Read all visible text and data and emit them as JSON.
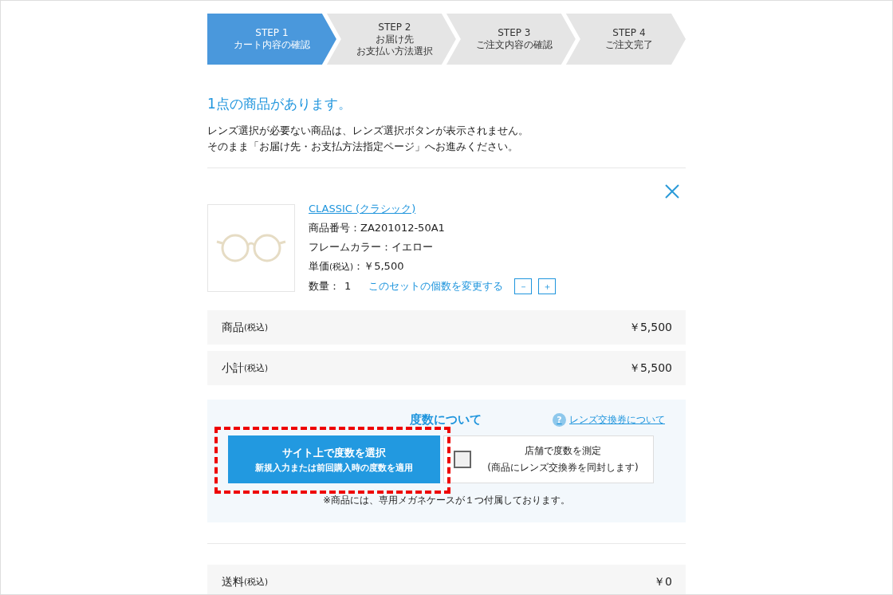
{
  "steps": [
    {
      "label": "STEP 1",
      "lines": [
        "カート内容の確認"
      ],
      "selected": true
    },
    {
      "label": "STEP 2",
      "lines": [
        "お届け先",
        "お支払い方法選択"
      ],
      "selected": false
    },
    {
      "label": "STEP 3",
      "lines": [
        "ご注文内容の確認"
      ],
      "selected": false
    },
    {
      "label": "STEP 4",
      "lines": [
        "ご注文完了"
      ],
      "selected": false
    }
  ],
  "heading": "1点の商品があります。",
  "notice": [
    "レンズ選択が必要ない商品は、レンズ選択ボタンが表示されません。",
    "そのまま「お届け先・お支払方法指定ページ」へお進みください。"
  ],
  "item": {
    "name": "CLASSIC (クラシック)",
    "product_number": "商品番号：ZA201012-50A1",
    "frame_color": "フレームカラー：イエロー",
    "price_label": "単価",
    "price_tax": "(税込)",
    "price_value": "：￥5,500",
    "qty_label": "数量：",
    "qty": "1",
    "change_qty": "このセットの個数を変更する",
    "minus": "－",
    "plus": "＋"
  },
  "summary": [
    {
      "label": "商品",
      "tax": "(税込)",
      "value": "￥5,500"
    },
    {
      "label": "小計",
      "tax": "(税込)",
      "value": "￥5,500"
    }
  ],
  "lens": {
    "title": "度数について",
    "help_link": "レンズ交換券について",
    "help_icon": "?",
    "online": {
      "title": "サイト上で度数を選択",
      "sub": "新規入力または前回購入時の度数を適用"
    },
    "store": {
      "title": "店舗で度数を測定",
      "sub": "(商品にレンズ交換券を同封します)",
      "checked": false
    },
    "note": "※商品には、専用メガネケースが１つ付属しております。"
  },
  "shipping": {
    "label": "送料",
    "tax": "(税込)",
    "value": "￥0"
  }
}
